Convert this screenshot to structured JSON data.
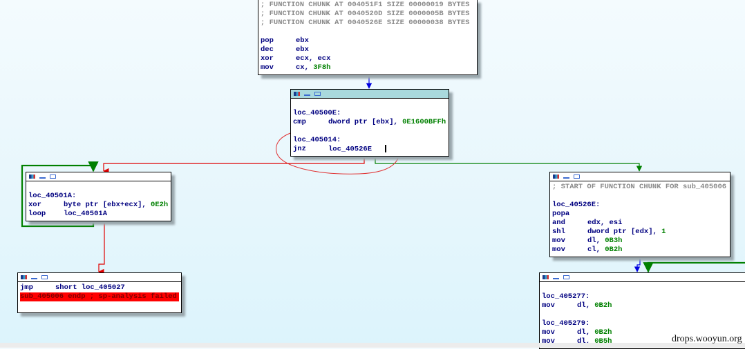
{
  "blocks": [
    {
      "id": "top",
      "selected": false,
      "header": false,
      "lines": [
        {
          "t": "comment",
          "text": "; FUNCTION CHUNK AT 004051F1 SIZE 00000019 BYTES"
        },
        {
          "t": "comment",
          "text": "; FUNCTION CHUNK AT 0040520D SIZE 0000005B BYTES"
        },
        {
          "t": "comment",
          "text": "; FUNCTION CHUNK AT 0040526E SIZE 00000038 BYTES"
        },
        {
          "t": "blank"
        },
        {
          "t": "ins",
          "mn": "pop",
          "op": "ebx"
        },
        {
          "t": "ins",
          "mn": "dec",
          "op": "ebx"
        },
        {
          "t": "ins",
          "mn": "xor",
          "op": "ecx, ecx"
        },
        {
          "t": "ins",
          "mn": "mov",
          "op": "cx, ",
          "imm": "3F8h"
        }
      ]
    },
    {
      "id": "loc_40500E",
      "selected": true,
      "header": true,
      "lines": [
        {
          "t": "blank"
        },
        {
          "t": "label",
          "text": "loc_40500E:"
        },
        {
          "t": "ins",
          "mn": "cmp",
          "op": "dword ptr [ebx], ",
          "imm": "0E1600BFFh"
        },
        {
          "t": "blank"
        },
        {
          "t": "label",
          "text": "loc_405014:"
        },
        {
          "t": "ins",
          "mn": "jnz",
          "op": "loc_40526E   ",
          "caret": true
        }
      ]
    },
    {
      "id": "loc_40501A",
      "selected": false,
      "header": true,
      "lines": [
        {
          "t": "blank"
        },
        {
          "t": "label",
          "text": "loc_40501A:"
        },
        {
          "t": "ins",
          "mn": "xor",
          "op": "byte ptr [ebx+ecx], ",
          "imm": "0E2h"
        },
        {
          "t": "ins",
          "mn": "loop",
          "op": "loc_40501A"
        }
      ]
    },
    {
      "id": "jmp_block",
      "selected": false,
      "header": true,
      "lines": [
        {
          "t": "ins",
          "mn": "jmp",
          "op": "short loc_405027"
        },
        {
          "t": "error",
          "text": "sub_405006 endp ; sp-analysis failed"
        },
        {
          "t": "blank"
        }
      ]
    },
    {
      "id": "loc_40526E",
      "selected": false,
      "header": true,
      "lines": [
        {
          "t": "comment",
          "text": "; START OF FUNCTION CHUNK FOR sub_405006"
        },
        {
          "t": "blank"
        },
        {
          "t": "label",
          "text": "loc_40526E:"
        },
        {
          "t": "ins",
          "mn": "popa",
          "op": ""
        },
        {
          "t": "ins",
          "mn": "and",
          "op": "edx, esi"
        },
        {
          "t": "ins",
          "mn": "shl",
          "op": "dword ptr [edx], ",
          "imm": "1"
        },
        {
          "t": "ins",
          "mn": "mov",
          "op": "dl, ",
          "imm": "0B3h"
        },
        {
          "t": "ins",
          "mn": "mov",
          "op": "cl, ",
          "imm": "0B2h"
        }
      ]
    },
    {
      "id": "loc_405277",
      "selected": false,
      "header": true,
      "lines": [
        {
          "t": "blank"
        },
        {
          "t": "label",
          "text": "loc_405277:"
        },
        {
          "t": "ins",
          "mn": "mov",
          "op": "dl, ",
          "imm": "0B2h"
        },
        {
          "t": "blank"
        },
        {
          "t": "label",
          "text": "loc_405279:"
        },
        {
          "t": "ins",
          "mn": "mov",
          "op": "dl, ",
          "imm": "0B2h"
        },
        {
          "t": "ins",
          "mn": "mov",
          "op": "dl, ",
          "imm": "0B5h"
        }
      ]
    }
  ],
  "colors": {
    "true_edge": "#008000",
    "false_edge": "#e00000",
    "flow_edge": "#0000e0",
    "annotation": "#e03030"
  },
  "watermark": "drops.wooyun.org"
}
